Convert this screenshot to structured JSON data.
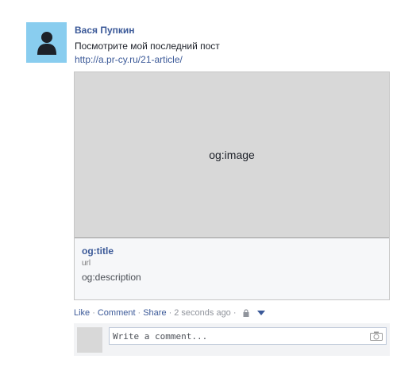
{
  "post": {
    "author": "Вася Пупкин",
    "text": "Посмотрите мой последний пост",
    "link": "http://a.pr-cy.ru/21-article/"
  },
  "card": {
    "image_label": "og:image",
    "title": "og:title",
    "url": "url",
    "description": "og:description"
  },
  "actions": {
    "like": "Like",
    "comment": "Comment",
    "share": "Share",
    "time": "2 seconds ago",
    "separator": "·"
  },
  "comment": {
    "placeholder": "Write a comment..."
  },
  "icons": {
    "avatar": "user-silhouette-icon",
    "privacy": "lock-icon",
    "menu": "caret-down-icon",
    "photo": "camera-icon"
  },
  "colors": {
    "avatar_bg": "#89cdef",
    "link": "#3b5998",
    "image_bg": "#d8d8d8"
  }
}
